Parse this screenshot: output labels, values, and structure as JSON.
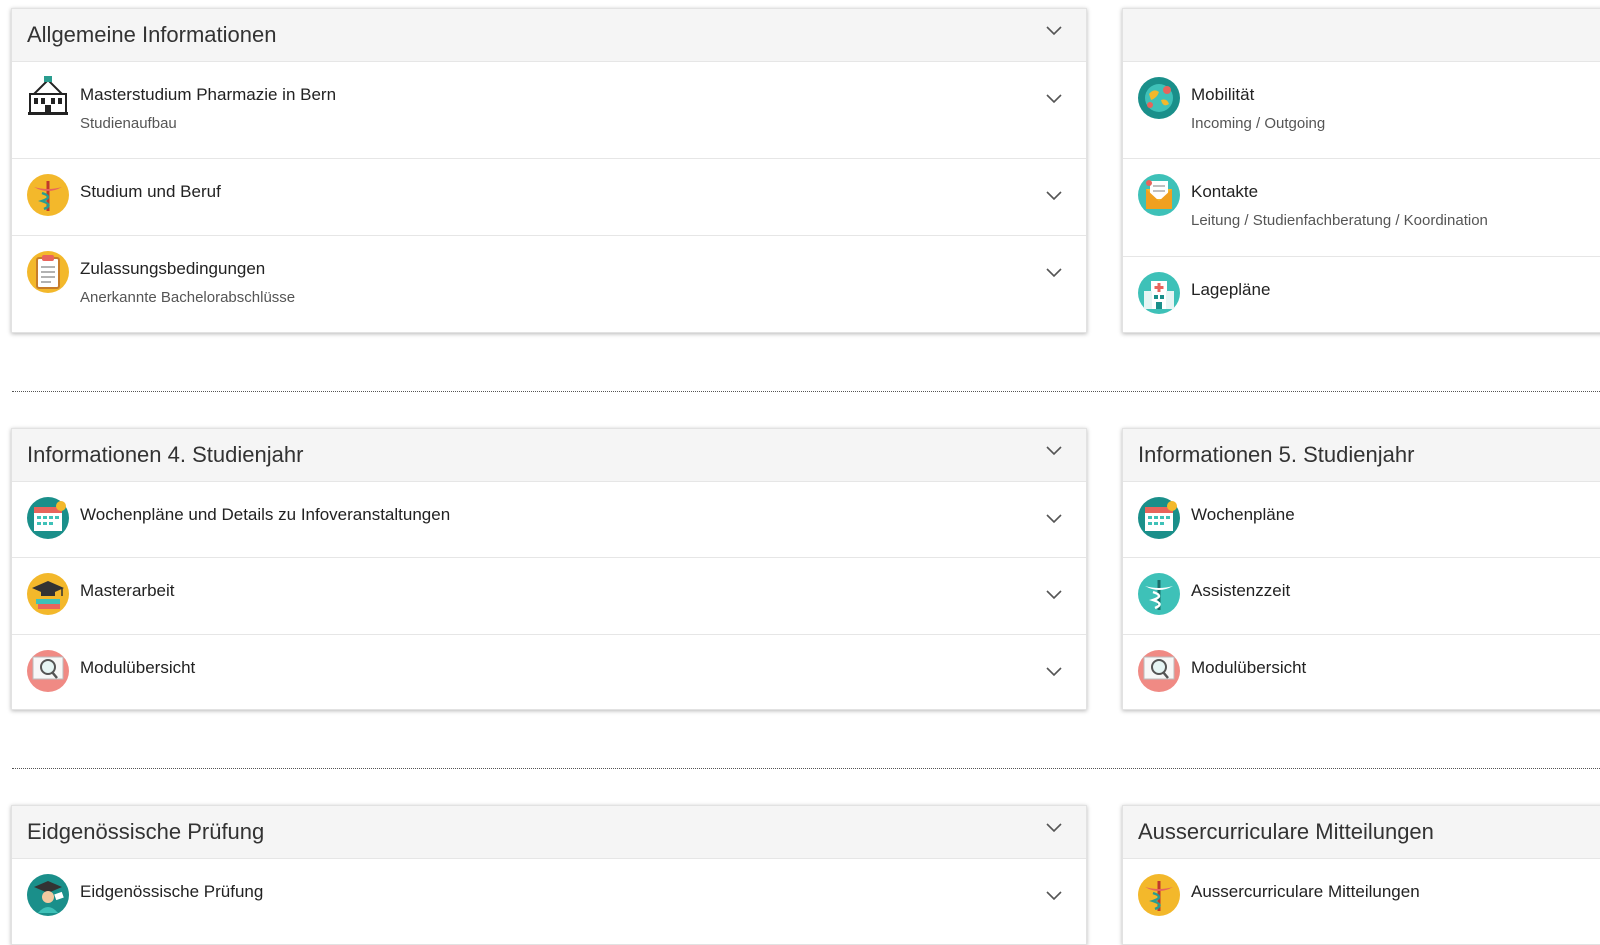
{
  "colors": {
    "teal": "#1a8f8a",
    "yellow": "#f3b82b",
    "red": "#e8645c",
    "header_bg": "#f5f5f5"
  },
  "sections": [
    {
      "title": "Allgemeine Informationen",
      "items": [
        {
          "title": "Masterstudium Pharmazie in Bern",
          "sub": "Studienaufbau",
          "icon": "building-icon"
        },
        {
          "title": "Studium und Beruf",
          "sub": "",
          "icon": "caduceus-icon"
        },
        {
          "title": "Zulassungsbedingungen",
          "sub": "Anerkannte Bachelorabschlüsse",
          "icon": "clipboard-icon"
        }
      ]
    },
    {
      "title": "",
      "items": [
        {
          "title": "Mobilität",
          "sub": "Incoming / Outgoing",
          "icon": "globe-icon"
        },
        {
          "title": "Kontakte",
          "sub": "Leitung / Studienfachberatung / Koordination",
          "icon": "envelope-icon"
        },
        {
          "title": "Lagepläne",
          "sub": "",
          "icon": "hospital-icon"
        }
      ]
    },
    {
      "title": "Informationen 4. Studienjahr",
      "items": [
        {
          "title": "Wochenpläne und Details zu Infoveranstaltungen",
          "sub": "",
          "icon": "calendar-icon"
        },
        {
          "title": "Masterarbeit",
          "sub": "",
          "icon": "graduation-cap-icon"
        },
        {
          "title": "Modulübersicht",
          "sub": "",
          "icon": "magnifier-icon"
        }
      ]
    },
    {
      "title": "Informationen 5. Studienjahr",
      "items": [
        {
          "title": "Wochenpläne",
          "sub": "",
          "icon": "calendar-icon"
        },
        {
          "title": "Assistenzzeit",
          "sub": "",
          "icon": "caduceus-icon"
        },
        {
          "title": "Modulübersicht",
          "sub": "",
          "icon": "magnifier-icon"
        }
      ]
    },
    {
      "title": "Eidgenössische Prüfung",
      "items": [
        {
          "title": "Eidgenössische Prüfung",
          "sub": "",
          "icon": "graduate-icon"
        }
      ]
    },
    {
      "title": "Aussercurriculare Mitteilungen",
      "items": [
        {
          "title": "Aussercurriculare Mitteilungen",
          "sub": "",
          "icon": "caduceus-icon"
        }
      ]
    }
  ]
}
